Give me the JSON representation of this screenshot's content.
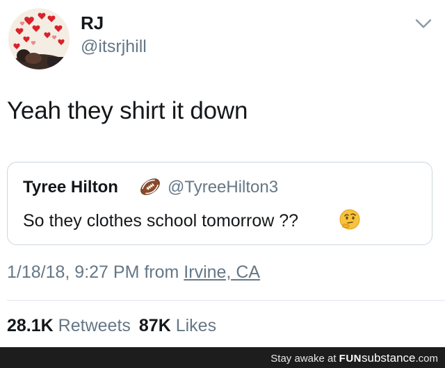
{
  "tweet": {
    "display_name": "RJ",
    "handle": "@itsrjhill",
    "text": "Yeah they shirt it down",
    "timestamp_prefix": "1/18/18, 9:27 PM from ",
    "location": "Irvine, CA",
    "retweets_count": "28.1K",
    "retweets_label": "Retweets",
    "likes_count": "87K",
    "likes_label": "Likes",
    "avatar_icon": "profile-photo-with-hearts",
    "menu_icon": "chevron-down-icon"
  },
  "quoted_tweet": {
    "display_name": "Tyree Hilton",
    "badge_icon": "american-football-emoji",
    "handle": "@TyreeHilton3",
    "text": "So they clothes school tomorrow ??",
    "trailing_emoji": "thinking-face-emoji"
  },
  "footer": {
    "prefix": "Stay awake at ",
    "brand": "FUN",
    "brand_rest": "substance",
    "suffix": ".com"
  },
  "colors": {
    "primary_text": "#14171a",
    "secondary_text": "#657786",
    "border": "#ccd6dd",
    "divider": "#e1e8ed",
    "footer_bg": "#1d1d1d"
  }
}
